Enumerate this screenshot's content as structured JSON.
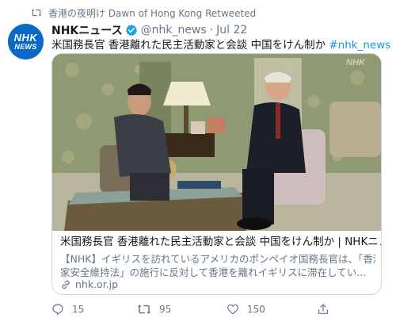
{
  "retweet": {
    "label": "香港の夜明け Dawn of Hong Kong Retweeted",
    "icon": "retweet-icon"
  },
  "tweet": {
    "avatar": {
      "line1": "NHK",
      "line2": "NEWS",
      "color": "#0a68c6"
    },
    "author_name": "NHKニュース",
    "verified_icon": "verified-badge-icon",
    "handle": "@nhk_news",
    "separator": "·",
    "date": "Jul 22",
    "text_main": "米国務長官 香港離れた民主活動家と会談 中国をけん制か ",
    "hashtag": "#nhk_news"
  },
  "card": {
    "image_watermark": "NHK",
    "title": "米国務長官 香港離れた民主活動家と会談 中国をけん制か | NHKニュース",
    "description_line1": "【NHK】イギリスを訪れているアメリカのポンペイオ国務長官は、「香港国",
    "description_line2": "家安全維持法」の施行に反対して香港を離れイギリスに滞在してい...",
    "domain": "nhk.or.jp",
    "link_icon": "link-icon"
  },
  "actions": {
    "reply_count": "15",
    "retweet_count": "95",
    "like_count": "150"
  },
  "colors": {
    "link_blue": "#1b95e0",
    "secondary_text": "#657786",
    "border": "#ccd6dd"
  }
}
